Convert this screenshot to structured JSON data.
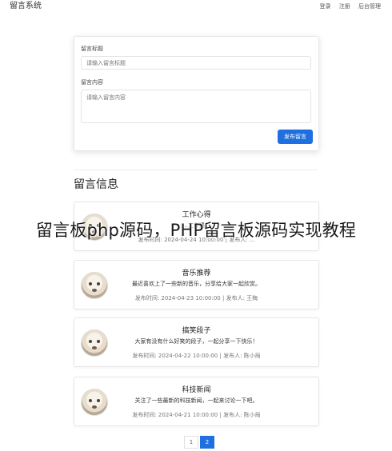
{
  "header": {
    "app_title": "留言系统",
    "nav": [
      "登录",
      "注册",
      "后台管理"
    ]
  },
  "form": {
    "title_label": "留言标题",
    "title_placeholder": "请输入留言标题",
    "content_label": "留言内容",
    "content_placeholder": "请输入留言内容",
    "submit_label": "发布留言"
  },
  "messages_section": {
    "title": "留言信息"
  },
  "messages": [
    {
      "title": "工作心得",
      "body": "...工作遇...",
      "meta": "发布时间: 2024-04-24 10:00:00 | 发布人: ..."
    },
    {
      "title": "音乐推荐",
      "body": "最近喜欢上了一些新的音乐，分享给大家一起欣赏。",
      "meta": "发布时间: 2024-04-23 10:00:00 | 发布人: 王梅"
    },
    {
      "title": "搞笑段子",
      "body": "大家有没有什么好笑的段子，一起分享一下快乐！",
      "meta": "发布时间: 2024-04-22 10:00:00 | 发布人: 陈小局"
    },
    {
      "title": "科技新闻",
      "body": "关注了一些最新的科技新闻，一起来讨论一下吧。",
      "meta": "发布时间: 2024-04-21 10:00:00 | 发布人: 陈小局"
    }
  ],
  "pagination": {
    "pages": [
      "1",
      "2"
    ],
    "current": "2"
  },
  "overlay_caption": "留言板php源码，PHP留言板源码实现教程",
  "colors": {
    "primary": "#1f6fe0",
    "border": "#e6e6e6",
    "text": "#333333"
  }
}
